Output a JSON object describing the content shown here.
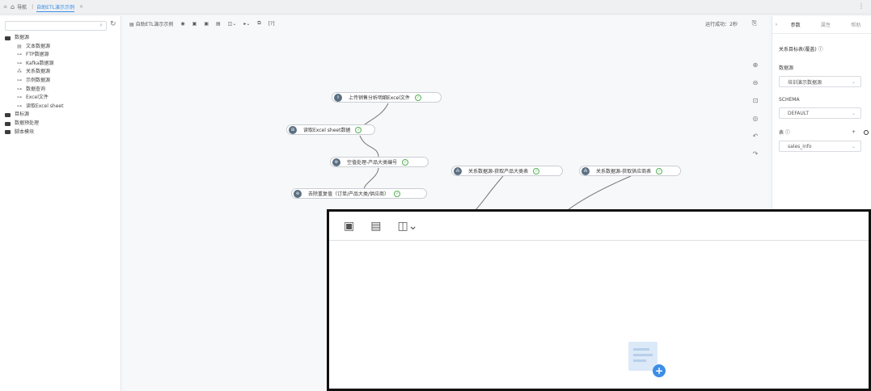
{
  "topbar": {
    "menu_icon": "≡",
    "home_icon": "home-icon",
    "nav_label": "导航",
    "separator": "|",
    "tab_label": "自助ETL演示示例",
    "close_label": "×",
    "more_label": "⋮"
  },
  "sidebar": {
    "items": [
      {
        "label": "数据源",
        "icon": "folder-icon"
      },
      {
        "label": "文本数据源",
        "icon": "text-icon"
      },
      {
        "label": "FTP数据源",
        "icon": "ftp-icon"
      },
      {
        "label": "Kafka数据源",
        "icon": "kafka-icon"
      },
      {
        "label": "关系数据源",
        "icon": "relation-icon"
      },
      {
        "label": "示例数据源",
        "icon": "sample-icon"
      },
      {
        "label": "数据查询",
        "icon": "query-icon"
      },
      {
        "label": "Excel文件",
        "icon": "excel-icon"
      },
      {
        "label": "读取Excel sheet",
        "icon": "sheet-icon"
      },
      {
        "label": "目标源",
        "icon": "folder-icon"
      },
      {
        "label": "数据预处理",
        "icon": "folder-icon"
      },
      {
        "label": "脚本模块",
        "icon": "folder-icon"
      }
    ]
  },
  "toolbar": {
    "title": "自助ETL演示示例",
    "help": "[?]",
    "status": "运行成功：2秒"
  },
  "canvas": {
    "nodes": [
      {
        "label": "上传销售分析明细Excel文件"
      },
      {
        "label": "读取Excel sheet数据"
      },
      {
        "label": "空值处理-产品大类编号"
      },
      {
        "label": "关系数据源-获取产品大类表"
      },
      {
        "label": "关系数据源-获取供应商表"
      },
      {
        "label": "去除重复值（订单/产品大类/供应商）"
      }
    ]
  },
  "right_panel": {
    "tabs": [
      "参数",
      "属性",
      "帮助"
    ],
    "section_title": "关系目标表(覆盖) ⓘ",
    "datasource_label": "数据源",
    "datasource_value": "培训演示数据源",
    "schema_label": "SCHEMA",
    "schema_value": "DEFAULT",
    "table_label": "表 ⓘ",
    "table_value": "sales_info",
    "plus": "+"
  }
}
